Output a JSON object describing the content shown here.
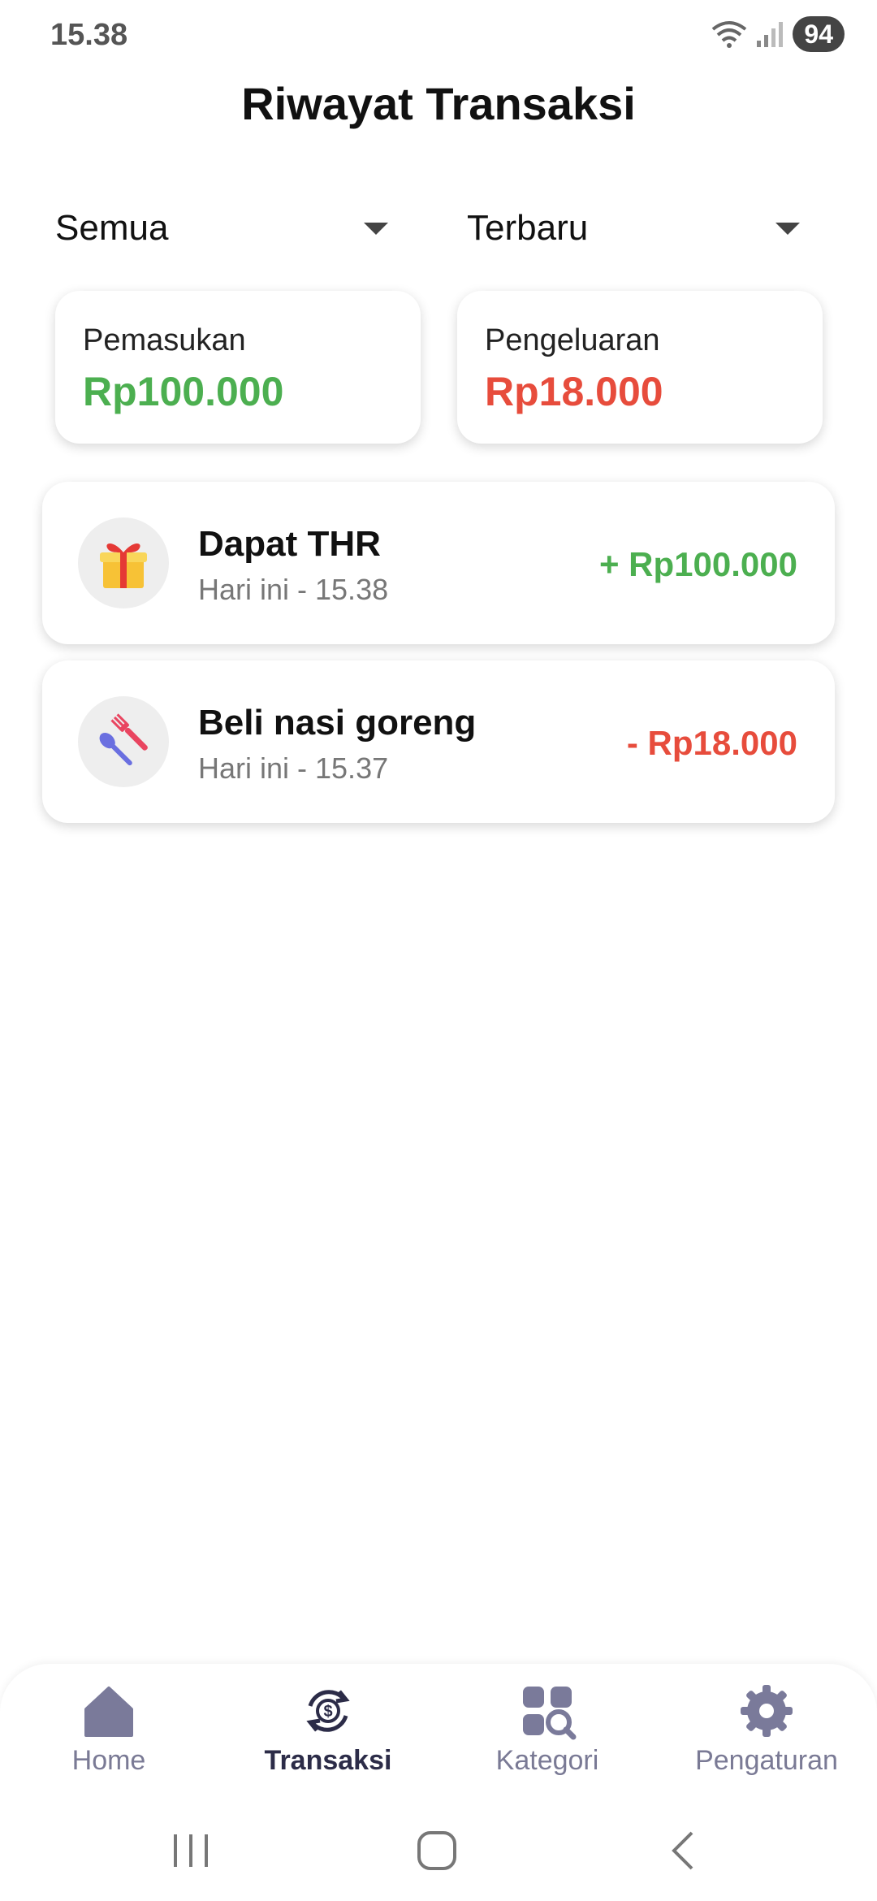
{
  "status_bar": {
    "time": "15.38",
    "battery": "94"
  },
  "header": {
    "title": "Riwayat Transaksi"
  },
  "filters": {
    "type": {
      "selected": "Semua"
    },
    "sort": {
      "selected": "Terbaru"
    }
  },
  "summary": {
    "income": {
      "label": "Pemasukan",
      "amount": "Rp100.000",
      "color": "#4caf50"
    },
    "expense": {
      "label": "Pengeluaran",
      "amount": "Rp18.000",
      "color": "#e74c3c"
    }
  },
  "transactions": [
    {
      "icon": "gift-icon",
      "title": "Dapat THR",
      "subtitle": "Hari ini - 15.38",
      "amount": "+ Rp100.000",
      "color": "#4caf50"
    },
    {
      "icon": "utensils-icon",
      "title": "Beli nasi goreng",
      "subtitle": "Hari ini - 15.37",
      "amount": "- Rp18.000",
      "color": "#e74c3c"
    }
  ],
  "bottom_nav": {
    "active": "Transaksi",
    "items": [
      {
        "label": "Home",
        "icon": "home-icon"
      },
      {
        "label": "Transaksi",
        "icon": "transaction-cycle-icon"
      },
      {
        "label": "Kategori",
        "icon": "category-search-icon"
      },
      {
        "label": "Pengaturan",
        "icon": "gear-icon"
      }
    ]
  },
  "colors": {
    "nav_icon": "#7a7a9a",
    "nav_active": "#2c2c48",
    "income": "#4caf50",
    "expense": "#e74c3c"
  }
}
